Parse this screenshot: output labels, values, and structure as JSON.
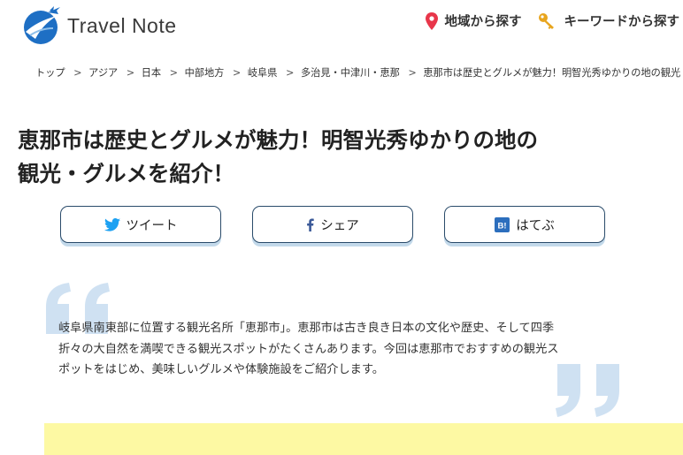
{
  "header": {
    "logo_text": "Travel Note",
    "nav": [
      {
        "label": "地域から探す",
        "icon": "map-pin-icon",
        "icon_color": "#e8364a"
      },
      {
        "label": "キーワードから探す",
        "icon": "key-icon",
        "icon_color": "#e8a51e"
      }
    ]
  },
  "breadcrumb": [
    "トップ",
    "アジア",
    "日本",
    "中部地方",
    "岐阜県",
    "多治見・中津川・恵那",
    "恵那市は歴史とグルメが魅力！明智光秀ゆかりの地の観光"
  ],
  "breadcrumb_separator": ">",
  "article": {
    "title_line1": "恵那市は歴史とグルメが魅力！明智光秀ゆかりの地の",
    "title_line2": "観光・グルメを紹介！",
    "share": {
      "tweet_label": "ツイート",
      "share_label": "シェア",
      "hatena_label": "はてぶ",
      "hatena_badge": "B!"
    },
    "intro_lines": [
      "岐阜県南東部に位置する観光名所「恵那市」。恵那市は古き良き日本の文化や歴史、そして四季",
      "折々の大自然を満喫できる観光スポットがたくさんあります。今回は恵那市でおすすめの観光ス",
      "ポットをはじめ、美味しいグルメや体験施設をご紹介します。"
    ]
  },
  "colors": {
    "brand_blue": "#1e6fc4",
    "quote_blue": "#cfe1f2",
    "highlight_yellow": "#fdf9a3",
    "twitter_blue": "#1da1f2",
    "facebook_blue": "#3b5998",
    "hatena_blue": "#2c6ebd"
  }
}
